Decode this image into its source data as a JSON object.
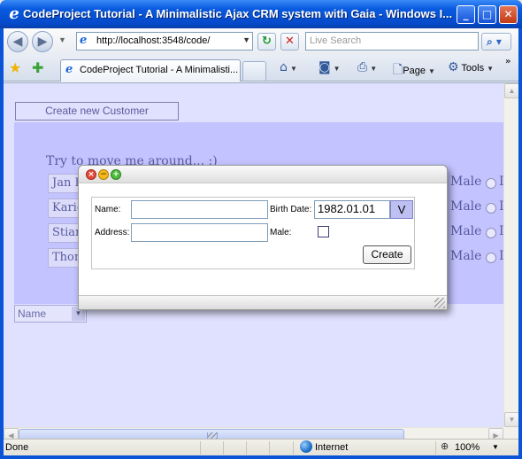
{
  "window": {
    "title": "CodeProject Tutorial - A Minimalistic Ajax CRM system with Gaia - Windows I...",
    "minimize": "_",
    "maximize": "□",
    "close": "✕"
  },
  "nav": {
    "back": "◀",
    "forward": "▶",
    "url": "http://localhost:3548/code/",
    "refresh": "↻",
    "stop": "✕",
    "search_placeholder": "Live Search",
    "search_icon": "search-icon"
  },
  "tabs": [
    {
      "label": "CodeProject Tutorial - A Minimalisti..."
    }
  ],
  "toolbar": {
    "home": "⌂",
    "feeds": "◙",
    "print": "⎙",
    "page_label": "Page",
    "tools_label": "Tools",
    "overflow": "»"
  },
  "page": {
    "create_customer_label": "Create new Customer",
    "hint": "Try to move me around... :)",
    "rows": [
      {
        "name": "Jan E",
        "gender": "Male"
      },
      {
        "name": "Karie",
        "gender": "Male"
      },
      {
        "name": "Stian",
        "gender": "Male"
      },
      {
        "name": "Thom",
        "gender": "Male"
      }
    ],
    "row_overflow": "I",
    "sort_select": "Name"
  },
  "dialog": {
    "name_label": "Name:",
    "name_value": "",
    "address_label": "Address:",
    "address_value": "",
    "birth_label": "Birth Date:",
    "birth_value": "1982.01.01",
    "date_picker_label": "V",
    "male_label": "Male:",
    "male_checked": false,
    "create_label": "Create"
  },
  "statusbar": {
    "status": "Done",
    "zone": "Internet",
    "zoom": "100%"
  },
  "colors": {
    "page_bg": "#e0e0ff",
    "grid_bg": "#c3c3ff",
    "titlebar": "#0a54d8"
  }
}
